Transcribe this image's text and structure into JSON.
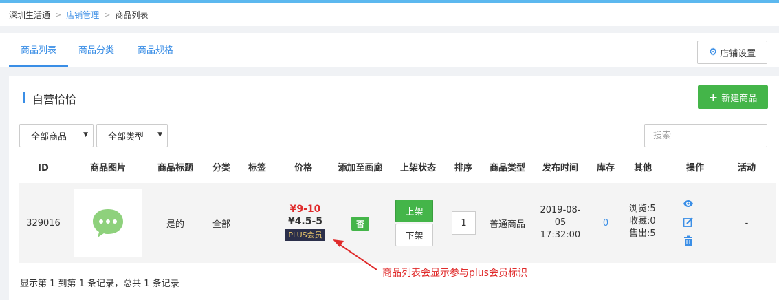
{
  "breadcrumb": {
    "items": [
      "深圳生活通",
      "店铺管理",
      "商品列表"
    ]
  },
  "tabs": [
    {
      "label": "商品列表",
      "active": true
    },
    {
      "label": "商品分类",
      "active": false
    },
    {
      "label": "商品规格",
      "active": false
    }
  ],
  "store_settings_label": "店铺设置",
  "store": {
    "title": "自营恰恰",
    "new_product_label": "新建商品"
  },
  "filters": {
    "product_filter": "全部商品",
    "type_filter": "全部类型",
    "search_placeholder": "搜索"
  },
  "table": {
    "headers": [
      "ID",
      "商品图片",
      "商品标题",
      "分类",
      "标签",
      "价格",
      "添加至画廊",
      "上架状态",
      "排序",
      "商品类型",
      "发布时间",
      "库存",
      "其他",
      "操作",
      "活动"
    ],
    "rows": [
      {
        "id": "329016",
        "title": "是的",
        "category": "全部",
        "tag": "",
        "price": "¥9-10",
        "plus_price": "¥4.5-5",
        "plus_badge": "PLUS会员",
        "gallery": "否",
        "on_shelf_label": "上架",
        "off_shelf_label": "下架",
        "sort": "1",
        "type": "普通商品",
        "published_date": "2019-08-",
        "published_day": "05",
        "published_time": "17:32:00",
        "stock": "0",
        "views": "浏览:5",
        "favorites": "收藏:0",
        "sold": "售出:5",
        "activity": "-"
      }
    ]
  },
  "footer": {
    "summary": "显示第 1 到第 1 条记录，总共 1 条记录"
  },
  "annotation": {
    "text": "商品列表会显示参与plus会员标识"
  },
  "colors": {
    "accent": "#3a8ee6",
    "success": "#44b549",
    "price": "#e02b2b",
    "plus_badge_bg": "#2b2f4a",
    "plus_badge_fg": "#e8c56b",
    "annotation": "#e02b2b"
  }
}
